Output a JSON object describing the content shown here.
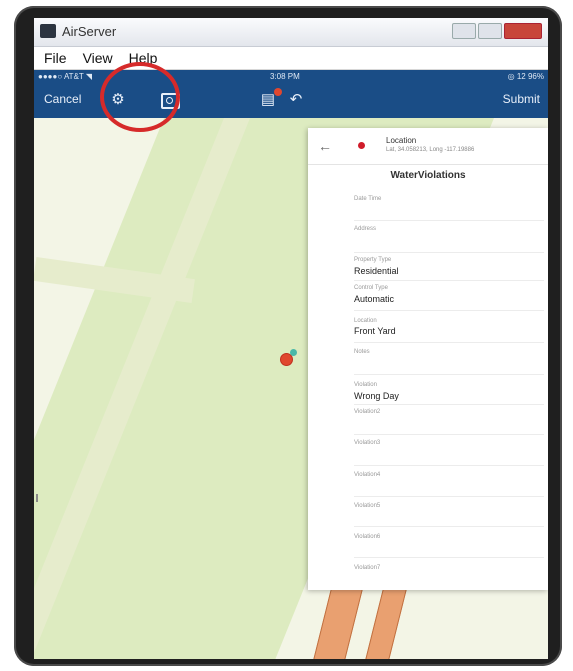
{
  "window": {
    "title": "AirServer",
    "buttons": [
      "",
      "",
      ""
    ]
  },
  "menubar": {
    "items": [
      "File",
      "View",
      "Help"
    ]
  },
  "statusbar": {
    "carrier": "●●●●○ AT&T ◥",
    "time": "3:08 PM",
    "battery": "◎ 12 96%"
  },
  "toolbar": {
    "cancel_label": "Cancel",
    "submit_label": "Submit"
  },
  "panel": {
    "location_title": "Location",
    "location_sub": "Lat, 34.058213, Long -117.19886",
    "form_title": "WaterViolations",
    "fields": [
      {
        "label": "Date Time",
        "value": ""
      },
      {
        "label": "Address",
        "value": ""
      },
      {
        "label": "Property Type",
        "value": "Residential"
      },
      {
        "label": "Control Type",
        "value": "Automatic"
      },
      {
        "label": "Location",
        "value": "Front Yard"
      },
      {
        "label": "Notes",
        "value": ""
      },
      {
        "label": "Violation",
        "value": "Wrong Day"
      },
      {
        "label": "Violation2",
        "value": ""
      },
      {
        "label": "Violation3",
        "value": ""
      },
      {
        "label": "Violation4",
        "value": ""
      },
      {
        "label": "Violation5",
        "value": ""
      },
      {
        "label": "Violation6",
        "value": ""
      },
      {
        "label": "Violation7",
        "value": ""
      }
    ]
  },
  "icons": {
    "settings": "gear-icon",
    "camera": "camera-icon",
    "attachment": "attachment-icon",
    "undo": "undo-icon"
  },
  "colors": {
    "toolbar_bg": "#1a4d86",
    "highlight_circle": "#d62a2a",
    "marker": "#e0472f"
  }
}
